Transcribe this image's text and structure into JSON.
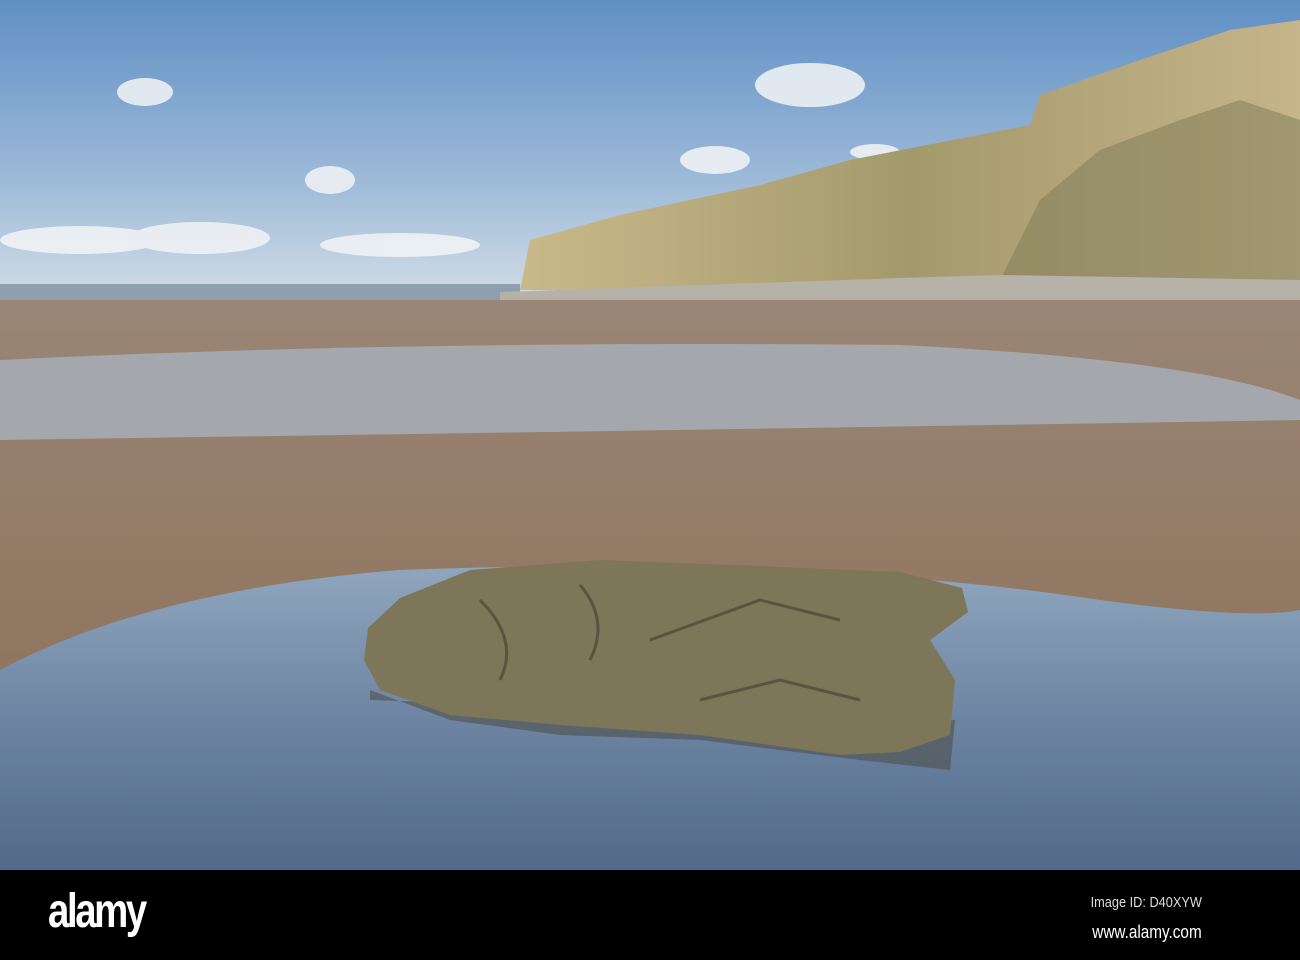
{
  "watermark": {
    "logo": "alamy"
  },
  "footer": {
    "image_id": "Image ID: D40XYW",
    "url": "www.alamy.com"
  }
}
